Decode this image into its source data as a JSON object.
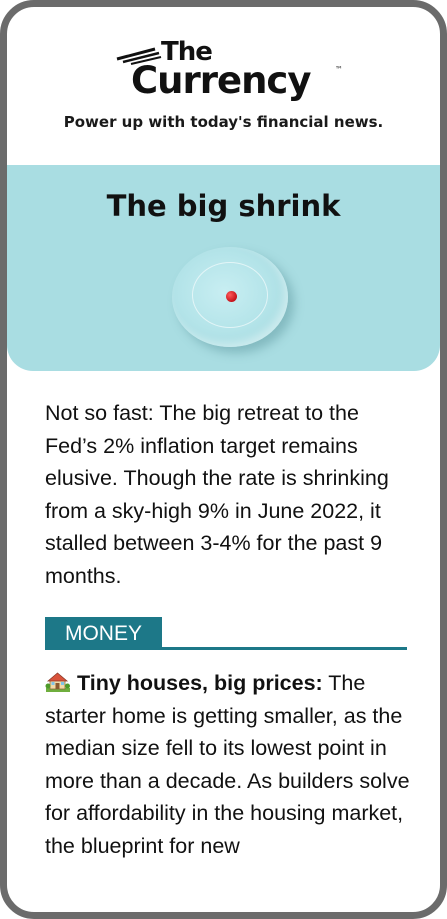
{
  "brand": {
    "logo_the": "The",
    "logo_currency": "Currency",
    "logo_tm": "™",
    "tagline": "Power up with today's financial news."
  },
  "hero": {
    "title": "The big shrink",
    "background_color": "#a9dde2"
  },
  "intro": {
    "text": "Not so fast: The big retreat to the Fed’s 2% inflation target remains elusive. Though the rate is shrinking from a sky-high 9% in June 2022, it stalled between 3-4% for the past 9 months."
  },
  "section": {
    "label": "MONEY",
    "color": "#1d7888"
  },
  "article": {
    "icon": "house-with-garden-icon",
    "lead": "Tiny houses, big prices:",
    "body": " The starter home is getting smaller, as the median size fell to its lowest point in more than a decade. As builders solve for affordability in the housing market, the blueprint for new"
  }
}
